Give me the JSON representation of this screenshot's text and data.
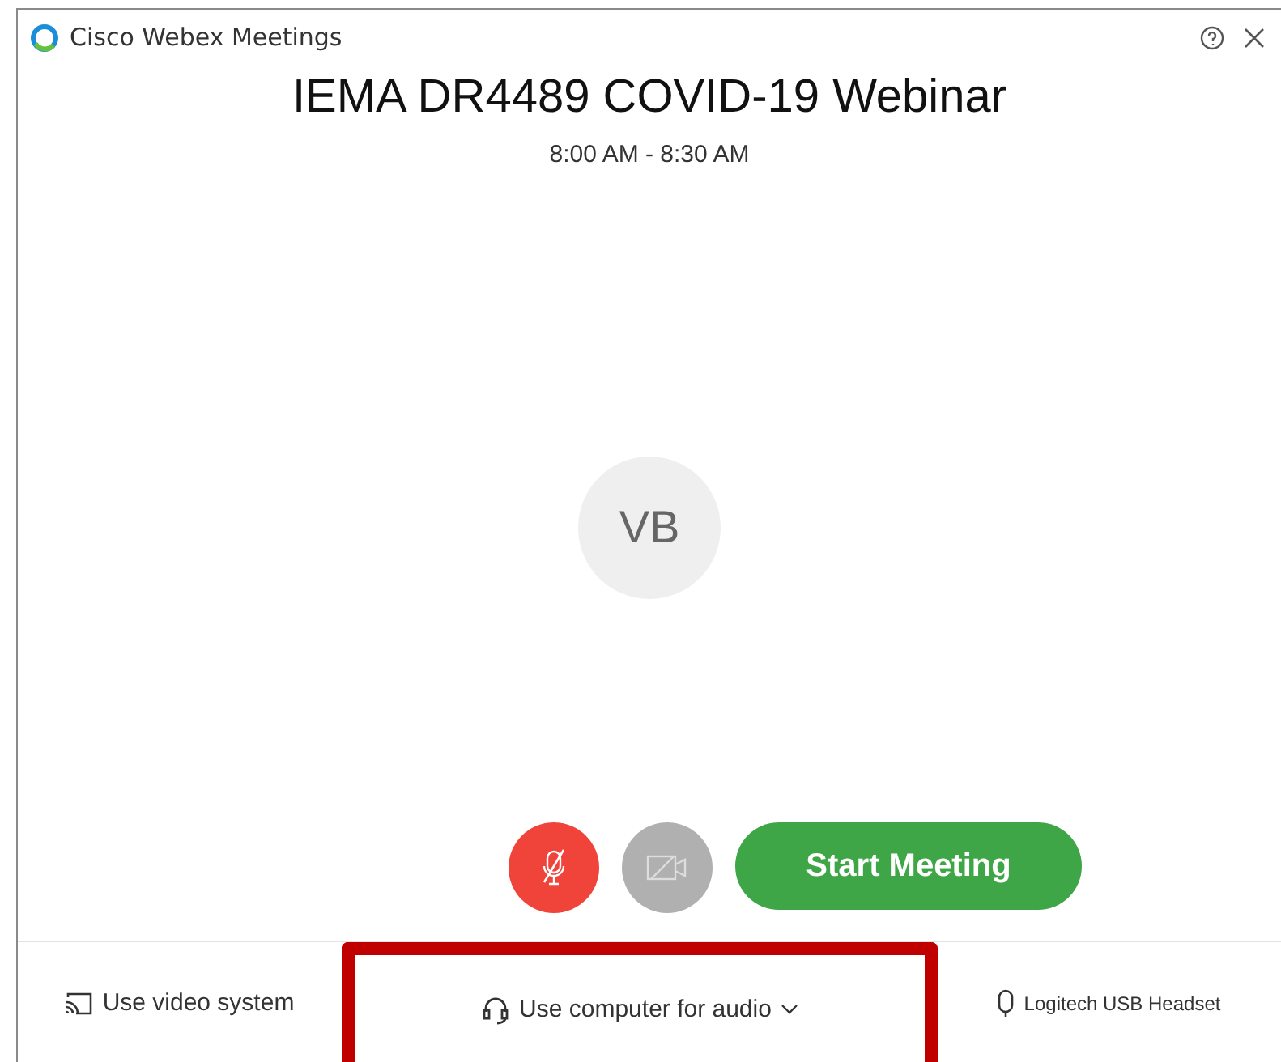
{
  "window": {
    "title": "Cisco Webex Meetings"
  },
  "meeting": {
    "title": "IEMA DR4489 COVID-19 Webinar",
    "time": "8:00 AM - 8:30 AM",
    "avatar_initials": "VB"
  },
  "controls": {
    "muted": true,
    "video_on": false,
    "start_label": "Start Meeting"
  },
  "footer": [
    {
      "kind": "video",
      "label": "Use video system",
      "highlighted": false
    },
    {
      "kind": "audio",
      "label": "Use computer for audio",
      "highlighted": true
    },
    {
      "kind": "device",
      "label": "Logitech USB Headset",
      "highlighted": false
    }
  ]
}
